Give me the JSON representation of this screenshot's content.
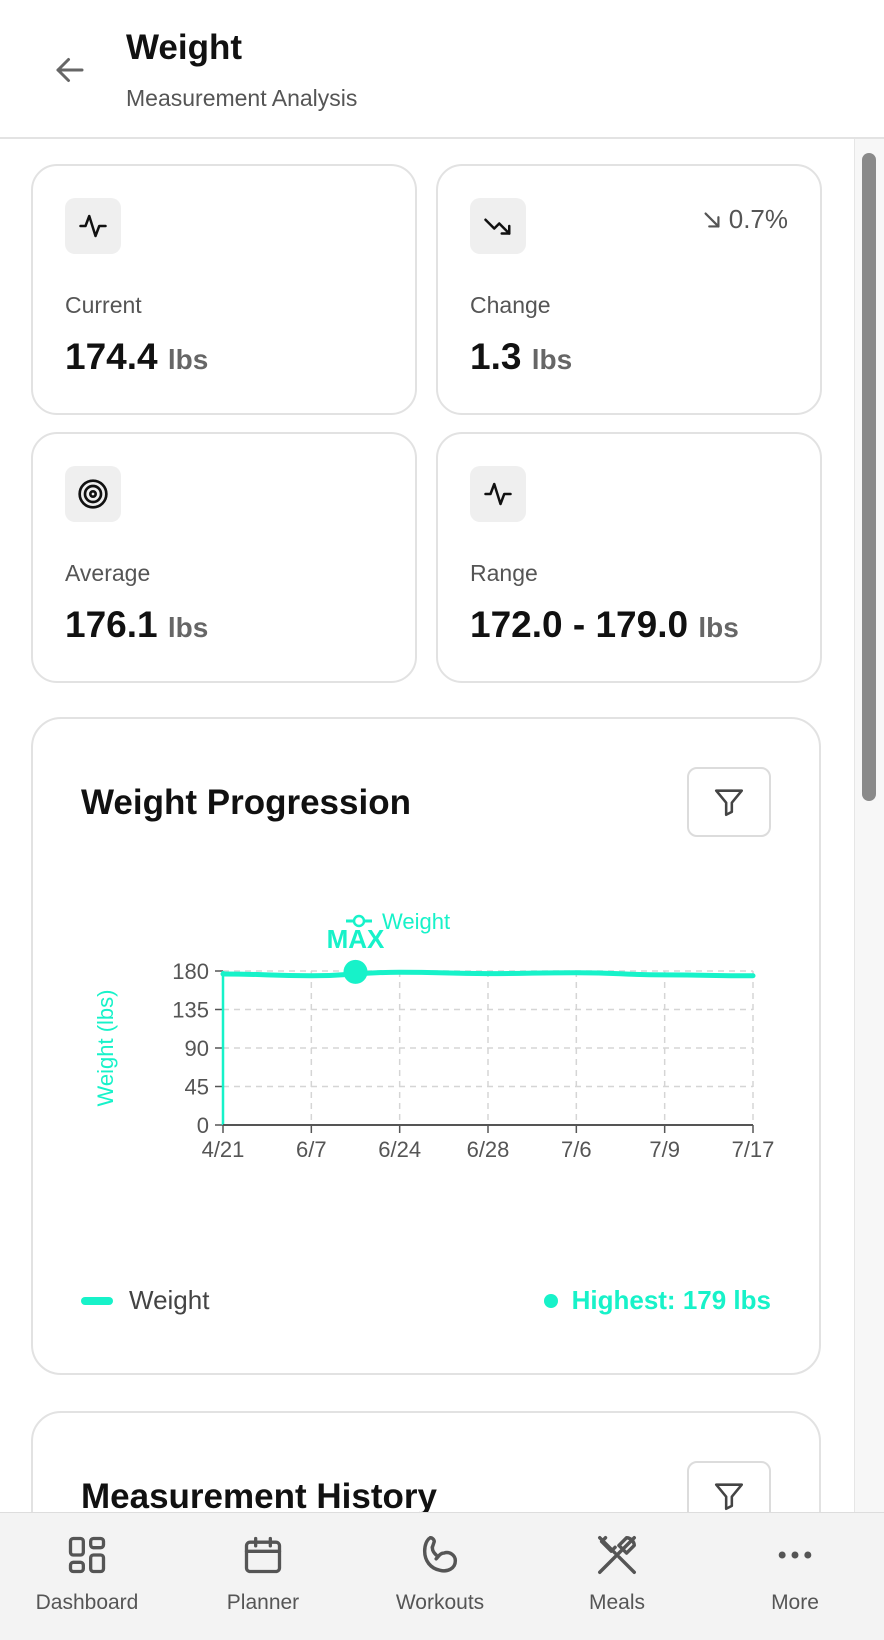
{
  "header": {
    "title": "Weight",
    "subtitle": "Measurement Analysis"
  },
  "stats": [
    {
      "icon": "activity-icon",
      "label": "Current",
      "value": "174.4",
      "unit": "lbs"
    },
    {
      "icon": "trending-down-icon",
      "label": "Change",
      "value": "1.3",
      "unit": "lbs",
      "change": "0.7%"
    },
    {
      "icon": "target-icon",
      "label": "Average",
      "value": "176.1",
      "unit": "lbs"
    },
    {
      "icon": "activity-icon",
      "label": "Range",
      "value": "172.0 - 179.0",
      "unit": "lbs"
    }
  ],
  "progression": {
    "title": "Weight Progression",
    "legend_label": "Weight",
    "highest_label": "Highest: 179 lbs",
    "max_marker": "MAX"
  },
  "history": {
    "title": "Measurement History"
  },
  "chart_data": {
    "type": "line",
    "categories": [
      "4/21",
      "6/7",
      "6/24",
      "6/28",
      "7/6",
      "7/9",
      "7/17"
    ],
    "series": [
      {
        "name": "Weight",
        "values": [
          176.5,
          174.5,
          178.5,
          177.0,
          178.0,
          175.5,
          174.4
        ]
      }
    ],
    "highlight": {
      "label": "MAX",
      "value": 179
    },
    "ylabel": "Weight (lbs)",
    "yticks": [
      0,
      45,
      90,
      135,
      180
    ],
    "ylim": [
      0,
      180
    ],
    "grid": true,
    "legend": "top",
    "color": "#17f2c9"
  },
  "nav": {
    "items": [
      {
        "label": "Dashboard",
        "icon": "dashboard-icon"
      },
      {
        "label": "Planner",
        "icon": "calendar-icon"
      },
      {
        "label": "Workouts",
        "icon": "bicep-icon"
      },
      {
        "label": "Meals",
        "icon": "utensils-icon"
      },
      {
        "label": "More",
        "icon": "more-icon"
      }
    ]
  },
  "colors": {
    "accent": "#17f2c9",
    "text": "#111111",
    "muted": "#555555"
  }
}
